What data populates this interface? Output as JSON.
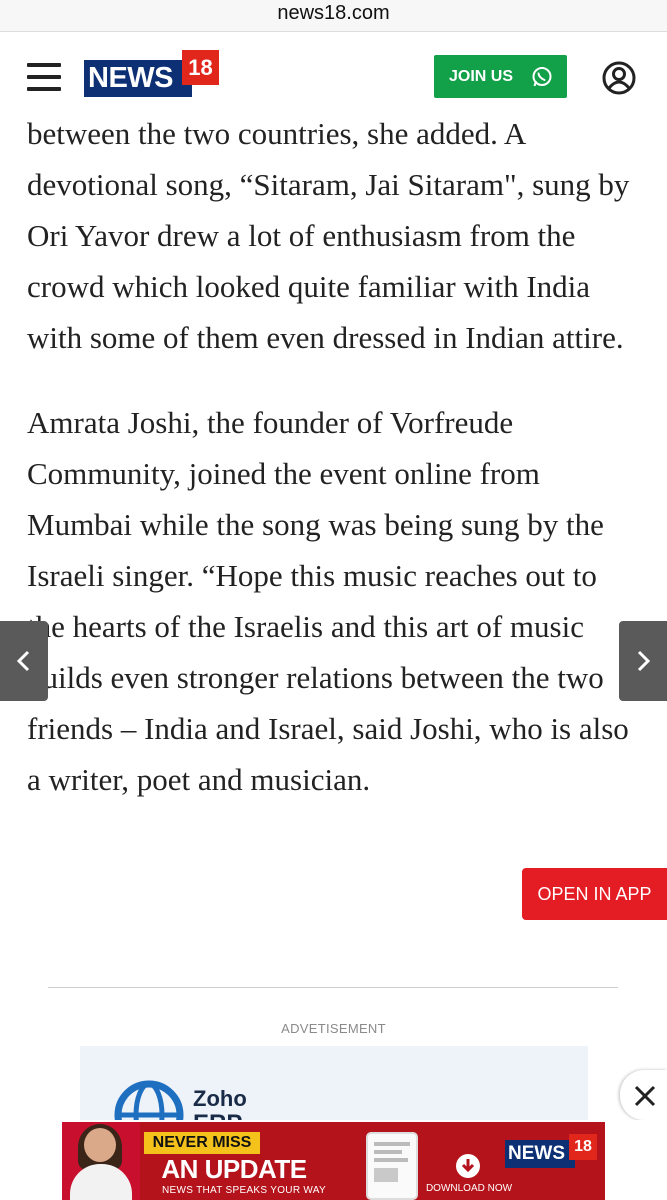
{
  "browser": {
    "url": "news18.com"
  },
  "header": {
    "logo_word": "NEWS",
    "logo_number": "18",
    "join_label": "JOIN US"
  },
  "article": {
    "paragraphs": [
      "between the two countries, she added. A devotional song, “Sitaram, Jai Sitaram\", sung by Ori Yavor drew a lot of enthusiasm from the crowd which looked quite familiar with India with some of them even dressed in Indian attire.",
      "Amrata Joshi, the founder of Vorfreude Community, joined the event online from Mumbai while the song was being sung by the Israeli singer. “Hope this music reaches out to the hearts of the Israelis and this art of music builds even stronger relations between the two friends – India and Israel, said Joshi, who is also a writer, poet and musician."
    ]
  },
  "open_app_label": "OPEN IN APP",
  "ad": {
    "label": "ADVETISEMENT",
    "brand": "Zoho",
    "product": "ERP"
  },
  "banner": {
    "tag": "NEVER MISS",
    "headline": "AN UPDATE",
    "subline": "NEWS THAT SPEAKS YOUR WAY",
    "download": "DOWNLOAD NOW",
    "logo_word": "NEWS",
    "logo_number": "18"
  },
  "colors": {
    "brand_navy": "#0d2f74",
    "brand_red": "#e1261c",
    "join_green": "#12a149",
    "open_app_red": "#e41c24",
    "banner_red": "#b4131b",
    "banner_yellow": "#f5c21b"
  },
  "icons": [
    "menu-icon",
    "whatsapp-icon",
    "user-icon",
    "chevron-left-icon",
    "chevron-right-icon",
    "close-icon",
    "zoho-globe-icon",
    "download-icon"
  ]
}
